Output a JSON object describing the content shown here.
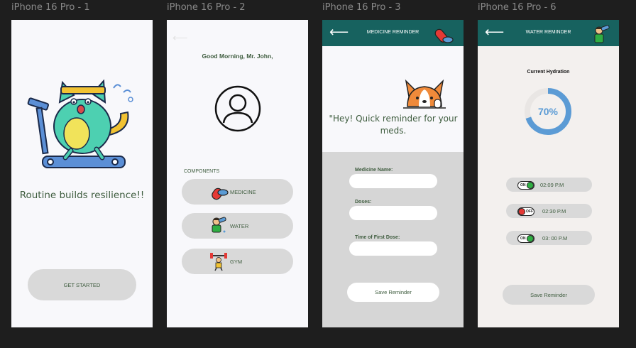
{
  "frames": [
    {
      "label": "iPhone 16 Pro - 1"
    },
    {
      "label": "iPhone 16 Pro - 2"
    },
    {
      "label": "iPhone 16 Pro - 3"
    },
    {
      "label": "iPhone 16 Pro - 6"
    }
  ],
  "screen1": {
    "tagline": "Routine builds resilience!!",
    "cta": "GET STARTED"
  },
  "screen2": {
    "greeting": "Good Morning, Mr. John,",
    "section": "COMPONENTS",
    "items": [
      {
        "label": "MEDICINE"
      },
      {
        "label": "WATER"
      },
      {
        "label": "GYM"
      }
    ]
  },
  "screen3": {
    "title": "MEDICINE REMINDER",
    "message": "\"Hey! Quick reminder for your meds.",
    "fields": [
      {
        "label": "Medicine Name:"
      },
      {
        "label": "Doses:"
      },
      {
        "label": "Time of First Dose:"
      }
    ],
    "save": "Save Reminder"
  },
  "screen4": {
    "title": "WATER REMINDER",
    "hydration_label": "Current Hydration",
    "hydration_value": "70%",
    "hydration_fraction": 0.7,
    "reminders": [
      {
        "state": "ON",
        "time": "02:09 P.M"
      },
      {
        "state": "OFF",
        "time": "02:30 P.M"
      },
      {
        "state": "ON",
        "time": "03: 00 P.M"
      }
    ],
    "save": "Save Reminder"
  },
  "colors": {
    "header": "#17625f",
    "accent_blue": "#5b9bd5",
    "switch_on": "#2fae43",
    "switch_off": "#e53935",
    "text_green": "#3e5c3e"
  }
}
